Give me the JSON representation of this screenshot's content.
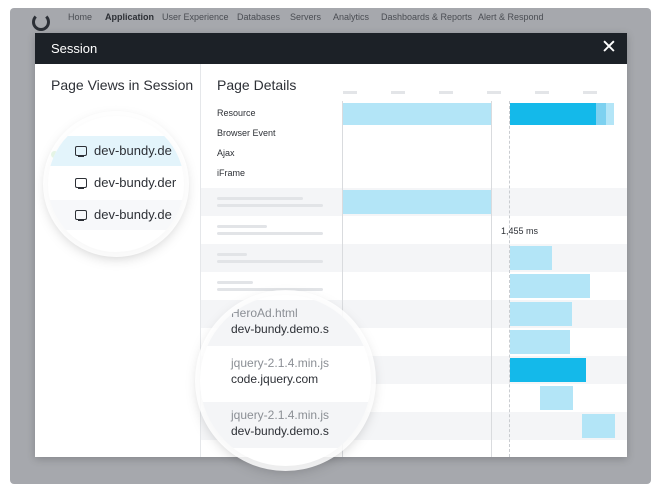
{
  "nav": {
    "items": [
      "Home",
      "Application",
      "User Experience",
      "Databases",
      "Servers",
      "Analytics",
      "Dashboards & Reports",
      "Alert & Respond"
    ],
    "active": "Application"
  },
  "modal": {
    "title": "Session",
    "close_label": "✕"
  },
  "left_panel": {
    "title": "Page Views in Session",
    "magnified_items": [
      "dev-bundy.de",
      "dev-bundy.der",
      "dev-bundy.de"
    ]
  },
  "right_panel": {
    "title": "Page Details",
    "legend_rows": [
      "Resource",
      "Browser Event",
      "Ajax",
      "iFrame"
    ],
    "duration_label": "1,455 ms",
    "magnified_items": [
      {
        "name": "HeroAd.html",
        "host": "dev-bundy.demo.s"
      },
      {
        "name": "jquery-2.1.4.min.js",
        "host": "code.jquery.com"
      },
      {
        "name": "jquery-2.1.4.min.js",
        "host": "dev-bundy.demo.s"
      }
    ]
  },
  "colors": {
    "header_bg": "#1c2127",
    "bar_light": "#b3e5f7",
    "bar_dark": "#14b9ea",
    "status_green": "#56c456"
  }
}
